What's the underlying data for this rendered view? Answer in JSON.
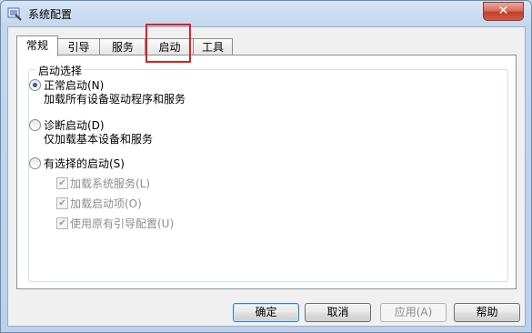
{
  "window": {
    "title": "系统配置",
    "close_label": "✕"
  },
  "tabs": [
    {
      "label": "常规",
      "active": true
    },
    {
      "label": "引导",
      "active": false
    },
    {
      "label": "服务",
      "active": false
    },
    {
      "label": "启动",
      "active": false
    },
    {
      "label": "工具",
      "active": false
    }
  ],
  "startup_group": {
    "title": "启动选择",
    "normal": {
      "label": "正常启动(N)",
      "desc": "加载所有设备驱动程序和服务",
      "selected": true
    },
    "diagnostic": {
      "label": "诊断启动(D)",
      "desc": "仅加载基本设备和服务",
      "selected": false
    },
    "selective": {
      "label": "有选择的启动(S)",
      "selected": false,
      "options": [
        {
          "label": "加载系统服务(L)",
          "checked": true
        },
        {
          "label": "加载启动项(O)",
          "checked": true
        },
        {
          "label": "使用原有引导配置(U)",
          "checked": true
        }
      ]
    }
  },
  "buttons": {
    "ok": "确定",
    "cancel": "取消",
    "apply": "应用(A)",
    "help": "帮助"
  }
}
